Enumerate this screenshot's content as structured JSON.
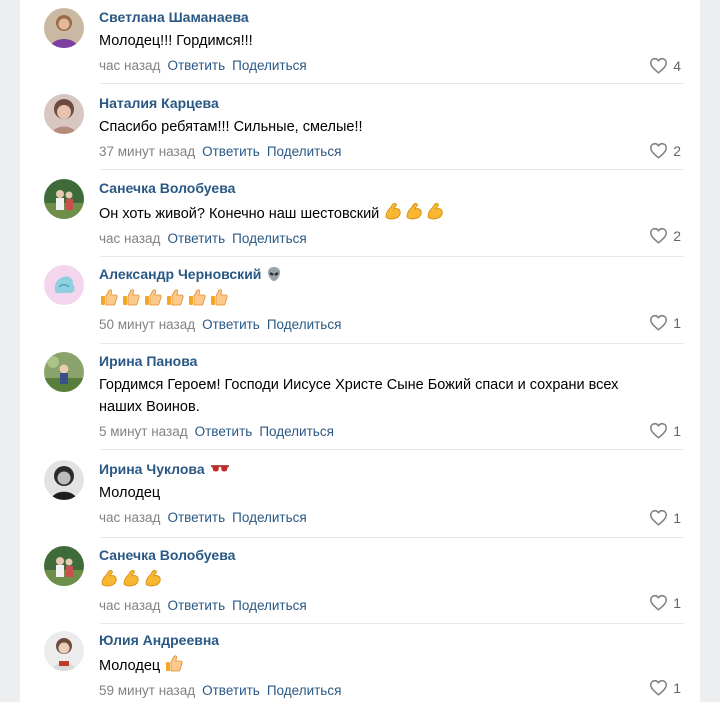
{
  "labels": {
    "reply": "Ответить",
    "share": "Поделиться"
  },
  "colors": {
    "link": "#2a5885",
    "meta": "#828282",
    "background": "#edeef0"
  },
  "comments": [
    {
      "author": "Светлана Шаманаева",
      "text": "Молодец!!! Гордимся!!!",
      "time": "час назад",
      "likes": "4",
      "avatar_icon": "user-photo"
    },
    {
      "author": "Наталия Карцева",
      "text": "Спасибо ребятам!!! Сильные, смелые!!",
      "time": "37 минут назад",
      "likes": "2",
      "avatar_icon": "user-photo"
    },
    {
      "author": "Санечка Волобуева",
      "text": "Он хоть живой? Конечно наш шестовский",
      "text_emoji": "flexed-biceps x3",
      "time": "час назад",
      "likes": "2",
      "avatar_icon": "user-photo"
    },
    {
      "author": "Александр Черновский",
      "author_emoji": "alien-icon",
      "text": "",
      "text_emoji": "thumbs-up x6",
      "time": "50 минут назад",
      "likes": "1",
      "avatar_icon": "user-photo"
    },
    {
      "author": "Ирина Панова",
      "text": "Гордимся Героем! Господи Иисусе Христе Сыне Божий спаси и сохрани всех наших Воинов.",
      "time": "5 минут назад",
      "likes": "1",
      "avatar_icon": "user-photo"
    },
    {
      "author": "Ирина Чуклова",
      "author_emoji": "sunglasses-icon",
      "text": "Молодец",
      "time": "час назад",
      "likes": "1",
      "avatar_icon": "user-photo"
    },
    {
      "author": "Санечка Волобуева",
      "text": "",
      "text_emoji": "flexed-biceps x3",
      "time": "час назад",
      "likes": "1",
      "avatar_icon": "user-photo"
    },
    {
      "author": "Юлия Андреевна",
      "text": "Молодец",
      "text_emoji": "thumbs-up x1",
      "time": "59 минут назад",
      "likes": "1",
      "avatar_icon": "user-photo"
    }
  ]
}
